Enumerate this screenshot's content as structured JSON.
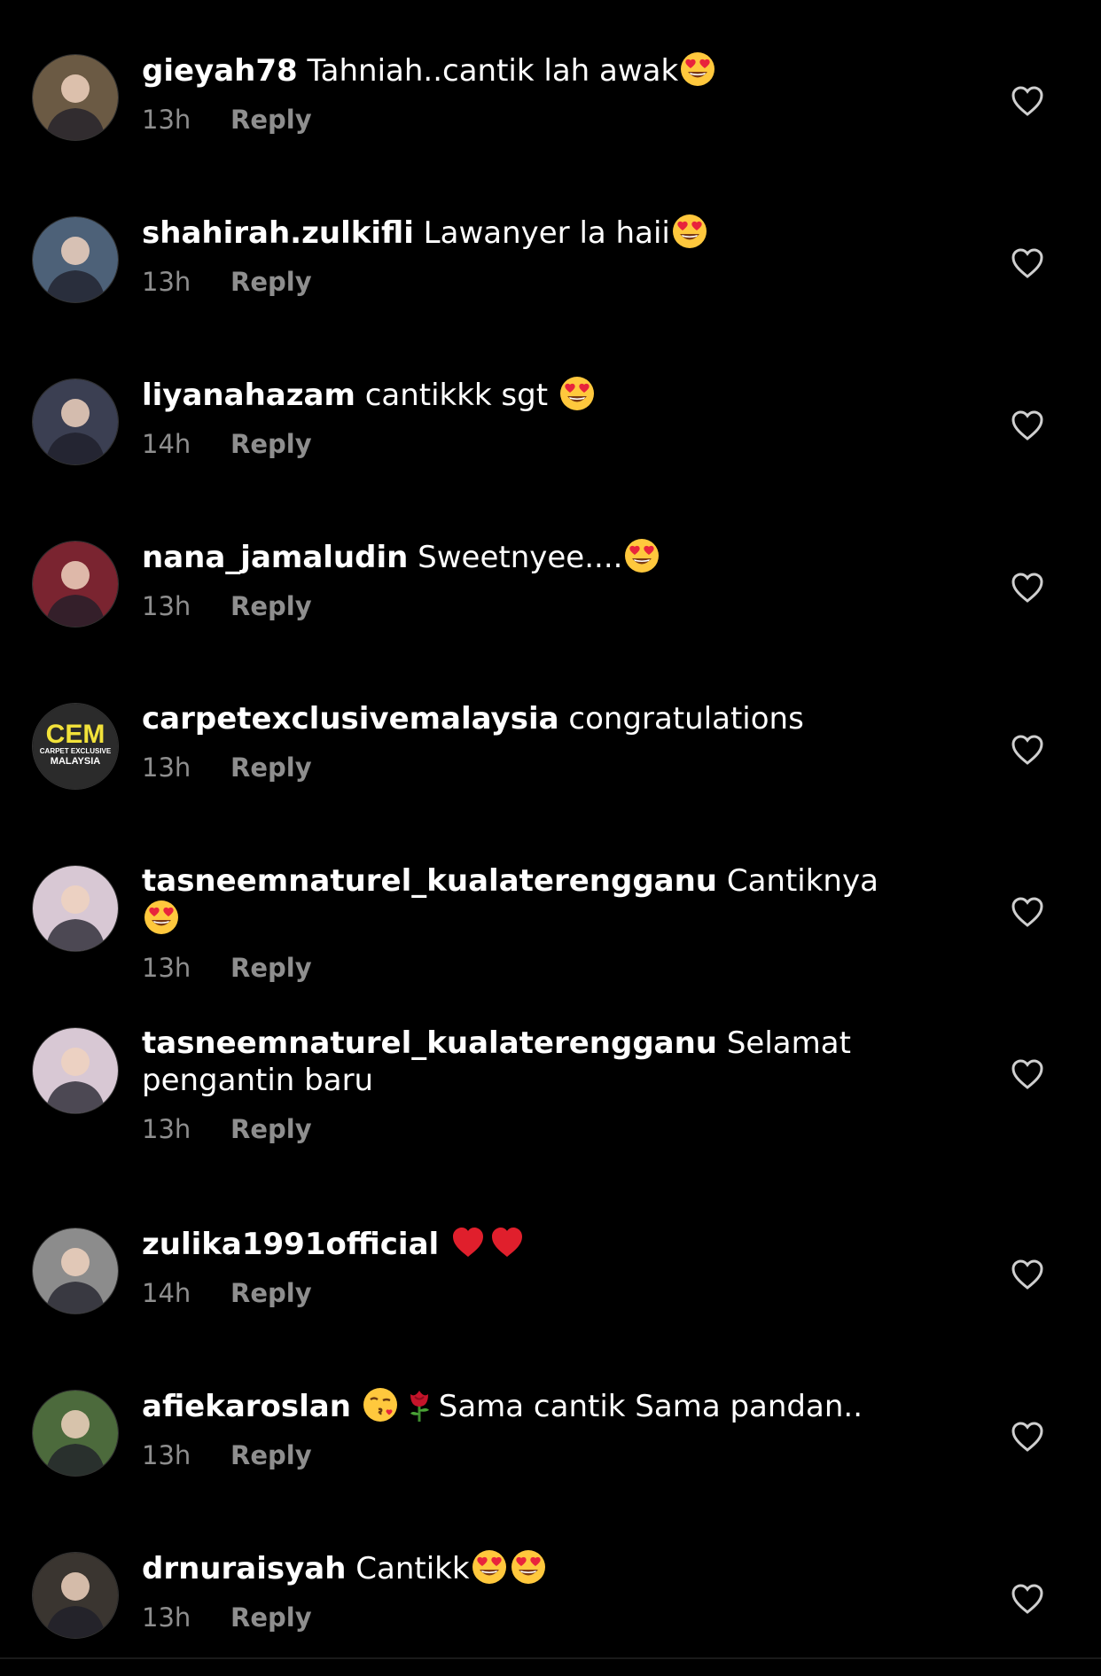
{
  "comments": [
    {
      "username": "gieyah78",
      "text_before": "Tahniah..cantik lah awak",
      "emojis": [
        "heart-eyes"
      ],
      "text_after": "",
      "time": "13h",
      "reply_label": "Reply",
      "avatar_color": "#6b5a44"
    },
    {
      "username": "shahirah.zulkifli",
      "text_before": "Lawanyer la haii",
      "emojis": [
        "heart-eyes"
      ],
      "text_after": "",
      "time": "13h",
      "reply_label": "Reply",
      "avatar_color": "#4d6178"
    },
    {
      "username": "liyanahazam",
      "text_before": "cantikkk sgt ",
      "emojis": [
        "heart-eyes"
      ],
      "text_after": "",
      "time": "14h",
      "reply_label": "Reply",
      "avatar_color": "#3b3f52"
    },
    {
      "username": "nana_jamaludin",
      "text_before": "Sweetnyee....",
      "emojis": [
        "heart-eyes"
      ],
      "text_after": "",
      "time": "13h",
      "reply_label": "Reply",
      "avatar_color": "#7a2430"
    },
    {
      "username": "carpetexclusivemalaysia",
      "text_before": "congratulations",
      "emojis": [],
      "text_after": "",
      "time": "13h",
      "reply_label": "Reply",
      "avatar_color": "#2a2a2a"
    },
    {
      "username": "tasneemnaturel_kualaterengganu",
      "text_before": "Cantiknya ",
      "emojis": [
        "heart-eyes"
      ],
      "text_after": "",
      "time": "13h",
      "reply_label": "Reply",
      "avatar_color": "#d8c8d4"
    },
    {
      "username": "tasneemnaturel_kualaterengganu",
      "text_before": "Selamat pengantin baru",
      "emojis": [],
      "text_after": "",
      "time": "13h",
      "reply_label": "Reply",
      "avatar_color": "#d8c8d4"
    },
    {
      "username": "zulika1991official",
      "text_before": "",
      "emojis": [
        "red-heart",
        "red-heart"
      ],
      "text_after": "",
      "time": "14h",
      "reply_label": "Reply",
      "avatar_color": "#8c8c8c"
    },
    {
      "username": "afiekaroslan",
      "text_before": "",
      "emojis": [
        "kiss-face",
        "rose"
      ],
      "text_after": "Sama cantik Sama pandan..",
      "time": "13h",
      "reply_label": "Reply",
      "avatar_color": "#4c6a3c"
    },
    {
      "username": "drnuraisyah",
      "text_before": "Cantikk",
      "emojis": [
        "heart-eyes",
        "heart-eyes"
      ],
      "text_after": "",
      "time": "13h",
      "reply_label": "Reply",
      "avatar_color": "#3a3530"
    }
  ],
  "avatar_logo_text": {
    "big": "CEM",
    "line1": "CARPET EXCLUSIVE",
    "line2": "MALAYSIA"
  },
  "icons": {
    "like": "heart-outline-icon"
  },
  "colors": {
    "background": "#000000",
    "text": "#ffffff",
    "meta": "#8e8e8e",
    "icon": "#cfcfcf"
  }
}
